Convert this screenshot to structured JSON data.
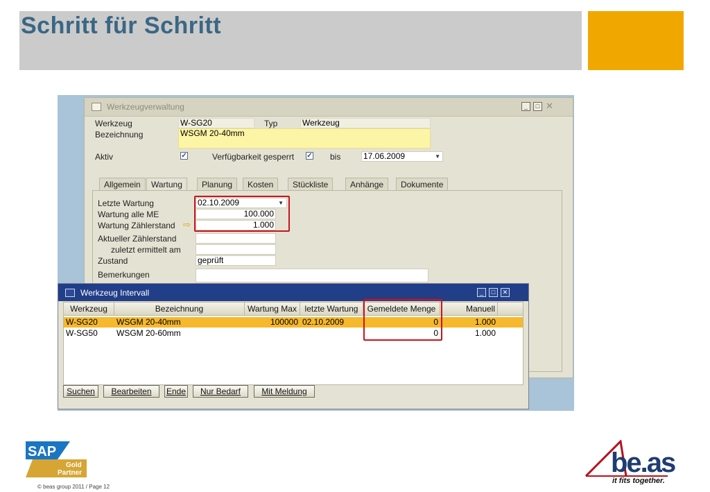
{
  "page": {
    "title": "Schritt für Schritt",
    "copyright": "© beas group 2011 / Page 12",
    "colors": {
      "title": "#3a6784",
      "accent": "#f0a800",
      "band": "#cbcbcb",
      "highlight_box": "#c8141e",
      "selected_row": "#f6b82c"
    }
  },
  "main_window": {
    "title": "Werkzeugverwaltung",
    "fields": {
      "werkzeug_label": "Werkzeug",
      "werkzeug_value": "W-SG20",
      "typ_label": "Typ",
      "typ_value": "Werkzeug",
      "bezeichnung_label": "Bezeichnung",
      "bezeichnung_value": "WSGM 20-40mm",
      "aktiv_label": "Aktiv",
      "aktiv_checked": true,
      "verfuegbarkeit_label": "Verfügbarkeit gesperrt",
      "verfuegbarkeit_checked": true,
      "bis_label": "bis",
      "bis_value": "17.06.2009"
    },
    "tabs": [
      "Allgemein",
      "Wartung",
      "Planung",
      "Kosten",
      "Stückliste",
      "Anhänge",
      "Dokumente"
    ],
    "active_tab": "Wartung",
    "wartung": {
      "letzte_wartung_label": "Letzte Wartung",
      "letzte_wartung_value": "02.10.2009",
      "wartung_alle_me_label": "Wartung alle ME",
      "wartung_alle_me_value": "100.000",
      "wartung_zaehlerstand_label": "Wartung Zählerstand",
      "wartung_zaehlerstand_value": "1.000",
      "aktueller_zaehlerstand_label": "Aktueller Zählerstand",
      "zuletzt_ermittelt_label": "zuletzt ermittelt am",
      "zustand_label": "Zustand",
      "zustand_value": "geprüft",
      "bemerkungen_label": "Bemerkungen"
    }
  },
  "popup": {
    "title": "Werkzeug Intervall",
    "columns": [
      "Werkzeug",
      "Bezeichnung",
      "Wartung Max",
      "letzte Wartung",
      "Gemeldete Menge",
      "Manuell"
    ],
    "rows": [
      {
        "werkzeug": "W-SG20",
        "bezeichnung": "WSGM 20-40mm",
        "wartung_max": "100000",
        "letzte_wartung": "02.10.2009",
        "gemeldete_menge": "0",
        "manuell": "1.000",
        "selected": true
      },
      {
        "werkzeug": "W-SG50",
        "bezeichnung": "WSGM 20-60mm",
        "wartung_max": "",
        "letzte_wartung": "",
        "gemeldete_menge": "0",
        "manuell": "1.000",
        "selected": false
      }
    ],
    "buttons": [
      "Suchen",
      "Bearbeiten",
      "Ende",
      "Nur Bedarf",
      "Mit Meldung"
    ]
  },
  "logos": {
    "sap_text": "SAP",
    "sap_gold": "Gold",
    "sap_partner": "Partner",
    "beas_text": "be.as",
    "beas_tagline": "it fits together."
  }
}
